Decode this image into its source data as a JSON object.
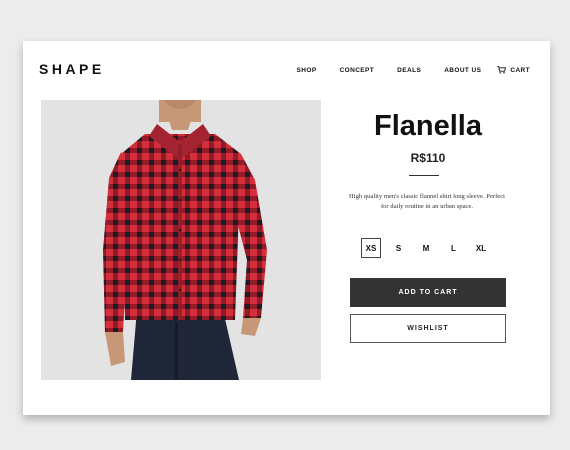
{
  "brand": {
    "logo": "SHAPE"
  },
  "nav": {
    "items": [
      {
        "label": "SHOP"
      },
      {
        "label": "CONCEPT"
      },
      {
        "label": "DEALS"
      },
      {
        "label": "ABOUT US"
      }
    ],
    "cart": {
      "label": "CART",
      "icon": "cart-icon"
    }
  },
  "product": {
    "name": "Flanella",
    "price": "R$110",
    "description": "High quality men's classic flannel shirt long sleeve. Perfect for daily routine in an urban space.",
    "image_alt": "Man wearing red and black plaid flannel shirt",
    "sizes": [
      "XS",
      "S",
      "M",
      "L",
      "XL"
    ],
    "selected_size": "XS",
    "add_to_cart_label": "ADD TO CART",
    "wishlist_label": "WISHLIST"
  },
  "colors": {
    "background": "#ececec",
    "card": "#ffffff",
    "primary_button": "#333333",
    "shirt_red": "#d32f3c",
    "shirt_dark": "#1c1c24"
  }
}
